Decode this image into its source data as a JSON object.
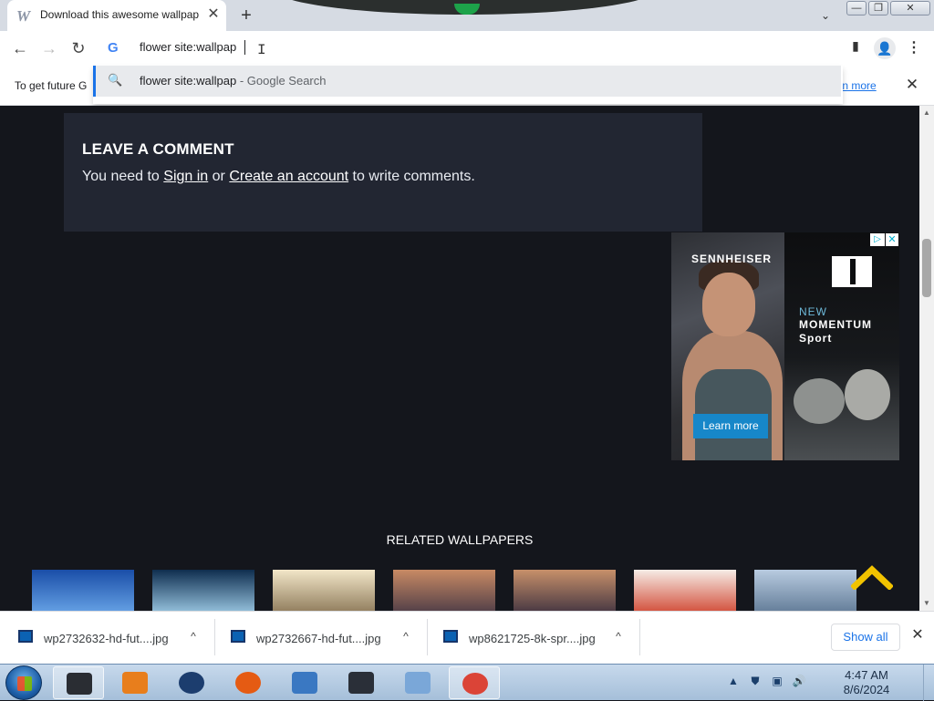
{
  "browser": {
    "tab": {
      "favicon": "W",
      "title": "Download this awesome wallpaper",
      "close": "✕"
    },
    "new_tab": "+",
    "tab_search": "⌄",
    "window_controls": {
      "minimize": "—",
      "restore": "❐",
      "close": "✕"
    },
    "nav": {
      "back": "←",
      "forward": "→",
      "reload": "↻"
    },
    "omnibox": {
      "engine_icon": "G",
      "value": "flower site:wallpap",
      "cursor": "I"
    },
    "toolbar_icons": {
      "side_panel": "▮",
      "profile": "👤",
      "menu": "⋮"
    },
    "suggestion": {
      "query": "flower site:wallpap",
      "suffix": " - Google Search",
      "icon": "🔍"
    },
    "infobar": {
      "message": "To get future G",
      "link": "earn more",
      "close": "✕"
    }
  },
  "page": {
    "comment": {
      "heading": "LEAVE A COMMENT",
      "text_before": "You need to ",
      "sign_in": "Sign in",
      "text_mid": " or ",
      "create_account": "Create an account",
      "text_after": " to write comments."
    },
    "ad": {
      "brand": "SENNHEISER",
      "line1": "NEW",
      "line2": "MOMENTUM",
      "line3": "Sport",
      "cta": "Learn more",
      "adchoices": "▷",
      "close": "✕"
    },
    "related_title": "RELATED WALLPAPERS",
    "thumbnails": [
      {
        "name": "thumb-1",
        "colors": [
          "#1a4ea8",
          "#6aa6e8"
        ]
      },
      {
        "name": "thumb-2",
        "colors": [
          "#0f2e4f",
          "#9ecbe6"
        ]
      },
      {
        "name": "thumb-3",
        "colors": [
          "#f2e6c8",
          "#8a7656"
        ]
      },
      {
        "name": "thumb-4",
        "colors": [
          "#c88a64",
          "#4a3a46"
        ]
      },
      {
        "name": "thumb-5",
        "colors": [
          "#c7906a",
          "#3f3240"
        ]
      },
      {
        "name": "thumb-6",
        "colors": [
          "#f6ece6",
          "#d04530"
        ]
      },
      {
        "name": "thumb-7",
        "colors": [
          "#b8cbe0",
          "#5e7894"
        ]
      }
    ],
    "scroll_top_color": "#f2c300"
  },
  "downloads": {
    "items": [
      {
        "name": "wp2732632-hd-fut....jpg",
        "chevron": "^"
      },
      {
        "name": "wp2732667-hd-fut....jpg",
        "chevron": "^"
      },
      {
        "name": "wp8621725-8k-spr....jpg",
        "chevron": "^"
      }
    ],
    "show_all": "Show all",
    "close": "✕"
  },
  "taskbar": {
    "apps": [
      {
        "name": "terminal",
        "color": "#2a2d33",
        "active": true
      },
      {
        "name": "media-player",
        "color": "#e87e1c",
        "active": false
      },
      {
        "name": "globe",
        "color": "#1c3d6e",
        "active": false
      },
      {
        "name": "firefox",
        "color": "#e55b13",
        "active": false
      },
      {
        "name": "remote-desktop",
        "color": "#3a78c2",
        "active": false
      },
      {
        "name": "monitor",
        "color": "#2a2f38",
        "active": false
      },
      {
        "name": "paint",
        "color": "#7aa7d8",
        "active": false
      },
      {
        "name": "chrome",
        "color": "#db4437",
        "active": true
      }
    ],
    "tray": {
      "up": "▲",
      "shield": "⛊",
      "network": "▣",
      "volume": "🔊"
    },
    "time": "4:47 AM",
    "date": "8/6/2024"
  }
}
